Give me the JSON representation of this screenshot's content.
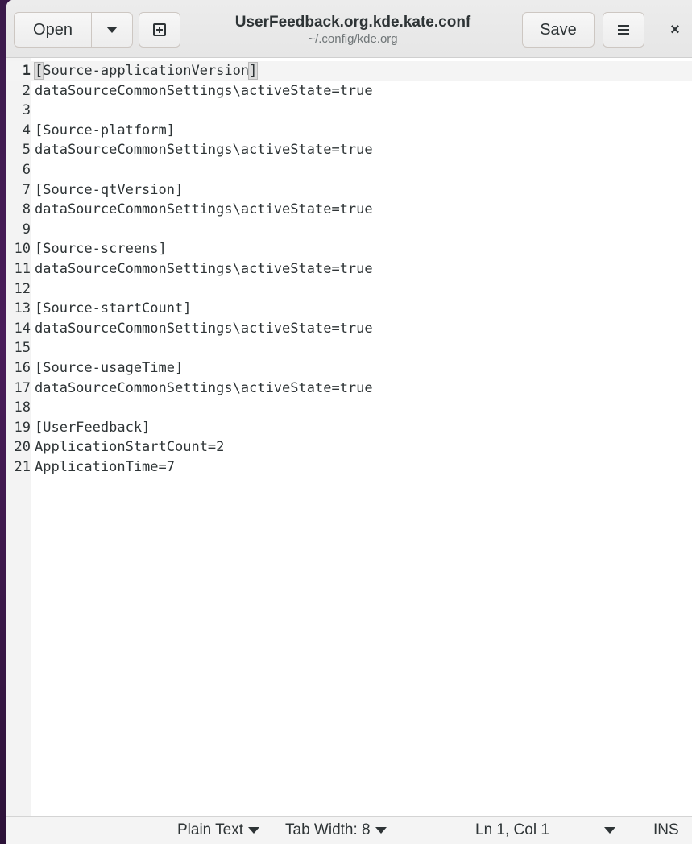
{
  "header": {
    "open_label": "Open",
    "open_menu_icon": "chevron-down",
    "new_tab_icon": "new-document",
    "title": "UserFeedback.org.kde.kate.conf",
    "subtitle": "~/.config/kde.org",
    "save_label": "Save",
    "menu_icon": "hamburger-menu",
    "close_glyph": "×"
  },
  "editor": {
    "cursor_line": 1,
    "lines": [
      {
        "n": "1",
        "text": "[Source-applicationVersion]"
      },
      {
        "n": "2",
        "text": "dataSourceCommonSettings\\activeState=true"
      },
      {
        "n": "3",
        "text": ""
      },
      {
        "n": "4",
        "text": "[Source-platform]"
      },
      {
        "n": "5",
        "text": "dataSourceCommonSettings\\activeState=true"
      },
      {
        "n": "6",
        "text": ""
      },
      {
        "n": "7",
        "text": "[Source-qtVersion]"
      },
      {
        "n": "8",
        "text": "dataSourceCommonSettings\\activeState=true"
      },
      {
        "n": "9",
        "text": ""
      },
      {
        "n": "10",
        "text": "[Source-screens]"
      },
      {
        "n": "11",
        "text": "dataSourceCommonSettings\\activeState=true"
      },
      {
        "n": "12",
        "text": ""
      },
      {
        "n": "13",
        "text": "[Source-startCount]"
      },
      {
        "n": "14",
        "text": "dataSourceCommonSettings\\activeState=true"
      },
      {
        "n": "15",
        "text": ""
      },
      {
        "n": "16",
        "text": "[Source-usageTime]"
      },
      {
        "n": "17",
        "text": "dataSourceCommonSettings\\activeState=true"
      },
      {
        "n": "18",
        "text": ""
      },
      {
        "n": "19",
        "text": "[UserFeedback]"
      },
      {
        "n": "20",
        "text": "ApplicationStartCount=2"
      },
      {
        "n": "21",
        "text": "ApplicationTime=7"
      }
    ]
  },
  "statusbar": {
    "language": "Plain Text",
    "tab_width": "Tab Width: 8",
    "cursor_position": "Ln 1, Col 1",
    "insert_mode": "INS"
  }
}
